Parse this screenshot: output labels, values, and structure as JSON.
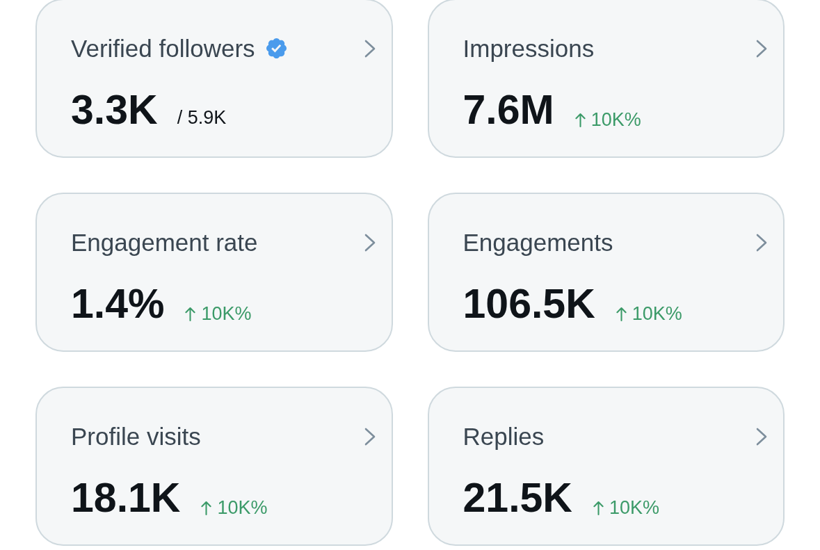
{
  "cards": [
    {
      "title": "Verified followers",
      "verified": true,
      "value": "3.3K",
      "total": "/ 5.9K"
    },
    {
      "title": "Impressions",
      "verified": false,
      "value": "7.6M",
      "change": {
        "up": true,
        "text": "10K%"
      }
    },
    {
      "title": "Engagement rate",
      "verified": false,
      "value": "1.4%",
      "change": {
        "up": true,
        "text": "10K%"
      }
    },
    {
      "title": "Engagements",
      "verified": false,
      "value": "106.5K",
      "change": {
        "up": true,
        "text": "10K%"
      }
    },
    {
      "title": "Profile visits",
      "verified": false,
      "value": "18.1K",
      "change": {
        "up": true,
        "text": "10K%"
      }
    },
    {
      "title": "Replies",
      "verified": false,
      "value": "21.5K",
      "change": {
        "up": true,
        "text": "10K%"
      }
    }
  ]
}
